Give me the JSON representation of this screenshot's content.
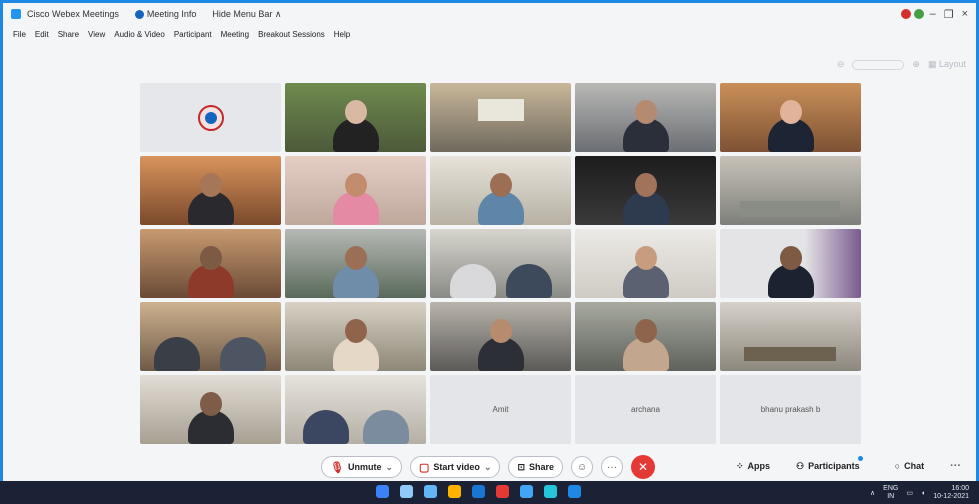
{
  "titlebar": {
    "app_name": "Cisco Webex Meetings",
    "meeting_info": "Meeting Info",
    "hide_menu": "Hide Menu Bar ∧",
    "minimize": "–",
    "restore": "❐",
    "close": "×"
  },
  "menu": {
    "items": [
      "File",
      "Edit",
      "Share",
      "View",
      "Audio & Video",
      "Participant",
      "Meeting",
      "Breakout Sessions",
      "Help"
    ]
  },
  "layout": {
    "label": "Layout"
  },
  "grid": {
    "named_tiles": [
      "Amit",
      "archana",
      "bhanu prakash b"
    ]
  },
  "toolbar": {
    "unmute": "Unmute",
    "start_video": "Start video",
    "share": "Share",
    "apps": "Apps",
    "participants": "Participants",
    "chat": "Chat",
    "more": "···"
  },
  "taskbar": {
    "lang": "ENG",
    "lang2": "IN",
    "time": "16:00",
    "date": "10-12-2021"
  },
  "colors": {
    "accent": "#1e88e5",
    "end_call": "#e53935",
    "muted": "#d32f2f"
  }
}
